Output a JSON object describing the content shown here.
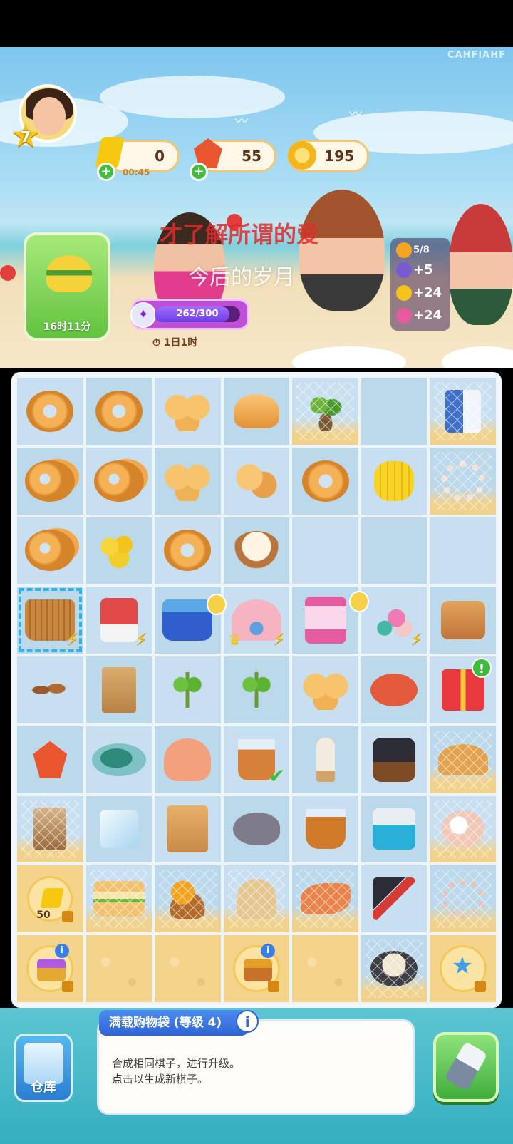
{
  "watermark": "CAHFIAHF",
  "player": {
    "level": "7"
  },
  "currencies": {
    "energy": "0",
    "energy_timer": "00:45",
    "gems": "55",
    "coins": "195"
  },
  "quest": {
    "time_left": "16时11分"
  },
  "event": {
    "progress_text": "262/300",
    "progress_fraction": 0.873,
    "timer": "1日1时"
  },
  "rewards": {
    "badge": "5/8",
    "items": [
      "+5",
      "+24",
      "+24"
    ]
  },
  "overlay_lyrics": [
    "才了解所谓的爱",
    "今后的岁月"
  ],
  "board": {
    "rows": [
      [
        "bagel",
        "bagel",
        "buns",
        "bun",
        "plant web",
        "empty",
        "milk web"
      ],
      [
        "bagel2",
        "bagel2",
        "buns",
        "bun2",
        "bagel",
        "corn",
        "pearls web"
      ],
      [
        "bagel2",
        "mango",
        "bagel",
        "cream",
        "empty",
        "empty",
        "empty"
      ],
      [
        "basket wicker selected bolt",
        "coffee bolt",
        "basket timer",
        "shell crown bolt",
        "claw timer",
        "coral bolt",
        "bag"
      ],
      [
        "nuts",
        "paperbag",
        "sprout",
        "sprout",
        "buns",
        "crab",
        "gift alert"
      ],
      [
        "gem",
        "turtle",
        "octopus",
        "tea check",
        "popsicle",
        "pot",
        "croissant web"
      ],
      [
        "latte web",
        "ice",
        "shopbag",
        "rock",
        "cup",
        "cooler",
        "pearl web"
      ],
      [
        "ticket sand lock",
        "sandwich web",
        "fruitbasket web",
        "bells web",
        "shrimp web",
        "spatula",
        "bracelet web"
      ],
      [
        "chest sand lock info",
        "sand",
        "sand",
        "chest gold sand lock info",
        "sand",
        "bowl web",
        "wand sand lock"
      ]
    ],
    "ticket_count": "50"
  },
  "info_panel": {
    "title": "满载购物袋 (等级 4)",
    "description": "合成相同棋子，进行升级。\n点击以生成新棋子。"
  },
  "buttons": {
    "storage": "仓库"
  }
}
